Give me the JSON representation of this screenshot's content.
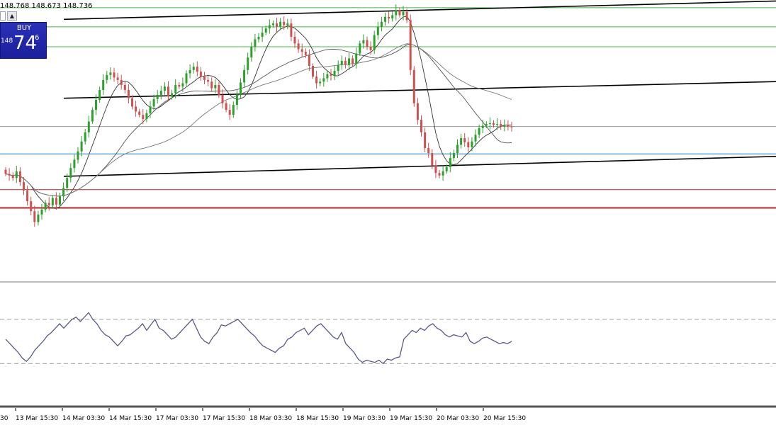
{
  "ohlc_readout": "148.768 148.673 148.736",
  "trade_panel": {
    "buy_label": "BUY",
    "price_small": "148",
    "price_big": "74",
    "price_sup": "6",
    "arrow": "▲"
  },
  "colors": {
    "bull": "#2ca02c",
    "bear": "#d05050",
    "support": "#1f77b4",
    "resistance_green": "#49b449",
    "red_level": "#b22222",
    "rsi": "#5a5a8c",
    "channel": "#000000",
    "buy_panel": "#1f25a8"
  },
  "chart_data": [
    {
      "type": "candlestick",
      "x_labels": [
        "13 Mar 15:30",
        "14 Mar 03:30",
        "14 Mar 15:30",
        "17 Mar 03:30",
        "17 Mar 15:30",
        "18 Mar 03:30",
        "18 Mar 15:30",
        "19 Mar 03:30",
        "19 Mar 15:30",
        "20 Mar 03:30",
        "20 Mar 15:30"
      ],
      "ylim": [
        146.7,
        150.0
      ],
      "series": [
        {
          "type": "candles",
          "values_close": [
            147.95,
            147.93,
            147.9,
            147.98,
            147.85,
            147.75,
            147.62,
            147.5,
            147.37,
            147.46,
            147.52,
            147.6,
            147.57,
            147.66,
            147.58,
            147.68,
            147.78,
            147.9,
            148.02,
            148.12,
            148.22,
            148.34,
            148.45,
            148.58,
            148.72,
            148.84,
            148.96,
            149.08,
            149.14,
            149.17,
            149.11,
            149.08,
            149.02,
            148.96,
            148.86,
            148.76,
            148.7,
            148.66,
            148.61,
            148.68,
            148.76,
            148.85,
            148.9,
            148.95,
            149.0,
            148.88,
            148.92,
            149.02,
            149.0,
            149.04,
            149.16,
            149.2,
            149.24,
            149.18,
            149.12,
            149.08,
            149.06,
            148.98,
            149.02,
            148.9,
            148.8,
            148.72,
            148.66,
            148.78,
            148.9,
            149.05,
            149.2,
            149.35,
            149.48,
            149.57,
            149.6,
            149.65,
            149.7,
            149.74,
            149.76,
            149.72,
            149.78,
            149.74,
            149.76,
            149.6,
            149.52,
            149.45,
            149.42,
            149.38,
            149.25,
            149.12,
            149.04,
            149.06,
            149.1,
            149.15,
            149.13,
            149.19,
            149.26,
            149.31,
            149.26,
            149.34,
            149.28,
            149.4,
            149.52,
            149.56,
            149.48,
            149.44,
            149.62,
            149.72,
            149.78,
            149.84,
            149.82,
            149.86,
            149.92,
            149.86,
            149.9,
            149.8,
            149.2,
            148.8,
            148.6,
            148.45,
            148.26,
            148.2,
            148.05,
            147.96,
            147.93,
            147.98,
            148.03,
            148.14,
            148.2,
            148.3,
            148.38,
            148.33,
            148.27,
            148.34,
            148.42,
            148.5,
            148.53,
            148.55,
            148.56,
            148.54,
            148.55,
            148.52,
            148.54,
            148.52,
            148.51
          ]
        },
        {
          "name": "",
          "type": "ma"
        },
        {
          "name": "",
          "type": "ma"
        }
      ],
      "levels": [
        {
          "value": 149.95,
          "color": "green"
        },
        {
          "value": 149.72,
          "color": "green"
        },
        {
          "value": 149.48,
          "color": "green"
        },
        {
          "value": 148.52,
          "color": "gray"
        },
        {
          "value": 148.19,
          "color": "blue"
        },
        {
          "value": 147.76,
          "color": "red"
        },
        {
          "value": 147.54,
          "color": "red"
        }
      ],
      "channel": [
        {
          "from": "14 Mar 03:30",
          "from_y": 149.81,
          "to_y": 150.03
        },
        {
          "from": "14 Mar 03:30",
          "from_y": 148.86,
          "to_y": 149.06
        },
        {
          "from": "14 Mar 03:30",
          "from_y": 147.92,
          "to_y": 148.16
        }
      ],
      "grid": false
    },
    {
      "type": "line",
      "name": "",
      "ylim": [
        0,
        100
      ],
      "levels": [
        70,
        30
      ],
      "values": [
        52,
        48,
        44,
        40,
        35,
        32,
        36,
        42,
        46,
        50,
        55,
        58,
        62,
        66,
        62,
        66,
        70,
        72,
        68,
        72,
        76,
        70,
        66,
        60,
        56,
        54,
        50,
        46,
        50,
        55,
        56,
        59,
        62,
        66,
        60,
        65,
        70,
        62,
        60,
        56,
        52,
        54,
        58,
        62,
        66,
        70,
        62,
        54,
        50,
        48,
        54,
        58,
        65,
        64,
        66,
        68,
        70,
        66,
        62,
        58,
        55,
        50,
        46,
        44,
        42,
        40,
        44,
        46,
        52,
        54,
        58,
        60,
        62,
        56,
        60,
        64,
        66,
        62,
        58,
        54,
        52,
        58,
        48,
        44,
        40,
        34,
        31,
        33,
        32,
        31,
        33,
        30,
        34,
        33,
        35,
        36,
        52,
        56,
        60,
        58,
        62,
        60,
        64,
        66,
        62,
        60,
        56,
        54,
        56,
        55,
        54,
        58,
        50,
        48,
        50,
        53,
        54,
        52,
        50,
        48,
        49,
        48,
        50
      ]
    }
  ]
}
